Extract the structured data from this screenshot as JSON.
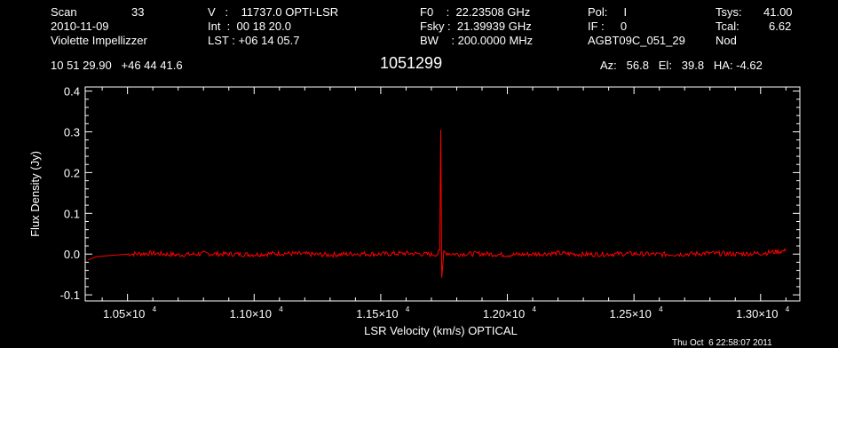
{
  "header": {
    "scan_label": "Scan",
    "scan_number": "33",
    "date": "2010-11-09",
    "observer": "Violette Impellizzer",
    "velocity": "V   :    11737.0 OPTI-LSR",
    "integration": "Int  :  00 18 20.0",
    "lst": "LST : +06 14 05.7",
    "f0": "F0    :  22.23508 GHz",
    "fsky": "Fsky :  21.39939 GHz",
    "bw": "BW    : 200.0000 MHz",
    "pol": "Pol:     I",
    "if": "IF :     0",
    "project": "AGBT09C_051_29",
    "tsys_label": "Tsys:",
    "tsys_value": "41.00",
    "tcal_label": "Tcal:",
    "tcal_value": "6.62",
    "mode": "Nod",
    "coords": "10 51 29.90   +46 44 41.6",
    "source": "1051299",
    "pointing": "Az:   56.8   El:   39.8   HA: -4.62"
  },
  "footer": {
    "timestamp": "Thu Oct  6 22:58:07 2011"
  },
  "colors": {
    "background": "#000000",
    "axes": "#ffffff",
    "trace": "#ff0000"
  },
  "chart_data": {
    "type": "line",
    "xlabel": "LSR Velocity (km/s) OPTICAL",
    "ylabel": "Flux Density (Jy)",
    "xlim": [
      10333,
      13155
    ],
    "ylim": [
      -0.115,
      0.41
    ],
    "x_ticks": [
      {
        "value": 10500,
        "label": "1.05×10",
        "exp": "4"
      },
      {
        "value": 11000,
        "label": "1.10×10",
        "exp": "4"
      },
      {
        "value": 11500,
        "label": "1.15×10",
        "exp": "4"
      },
      {
        "value": 12000,
        "label": "1.20×10",
        "exp": "4"
      },
      {
        "value": 12500,
        "label": "1.25×10",
        "exp": "4"
      },
      {
        "value": 13000,
        "label": "1.30×10",
        "exp": "4"
      }
    ],
    "y_ticks": [
      {
        "value": -0.1,
        "label": "-0.1"
      },
      {
        "value": 0.0,
        "label": "0.0"
      },
      {
        "value": 0.1,
        "label": "0.1"
      },
      {
        "value": 0.2,
        "label": "0.2"
      },
      {
        "value": 0.3,
        "label": "0.3"
      },
      {
        "value": 0.4,
        "label": "0.4"
      }
    ],
    "series": [
      {
        "x": [
          10500,
          10600,
          10700,
          10800,
          10900,
          11000,
          11100,
          11200,
          11300,
          11400,
          11500,
          11600,
          11700,
          11725,
          11733,
          11737,
          11741,
          11749,
          11775,
          11800,
          11900,
          12000,
          12100,
          12200,
          12300,
          12400,
          12500,
          12600,
          12700,
          12800,
          12900,
          13000,
          13100
        ],
        "y": [
          0.0,
          0.002,
          -0.002,
          0.001,
          0.0,
          -0.001,
          0.002,
          0.0,
          -0.002,
          0.001,
          0.0,
          0.002,
          -0.001,
          0.0,
          0.01,
          0.305,
          -0.058,
          0.004,
          0.001,
          0.0,
          0.001,
          -0.002,
          0.0,
          0.002,
          -0.001,
          0.0,
          0.001,
          -0.001,
          0.0,
          0.002,
          0.0,
          0.002,
          0.008
        ]
      }
    ]
  }
}
